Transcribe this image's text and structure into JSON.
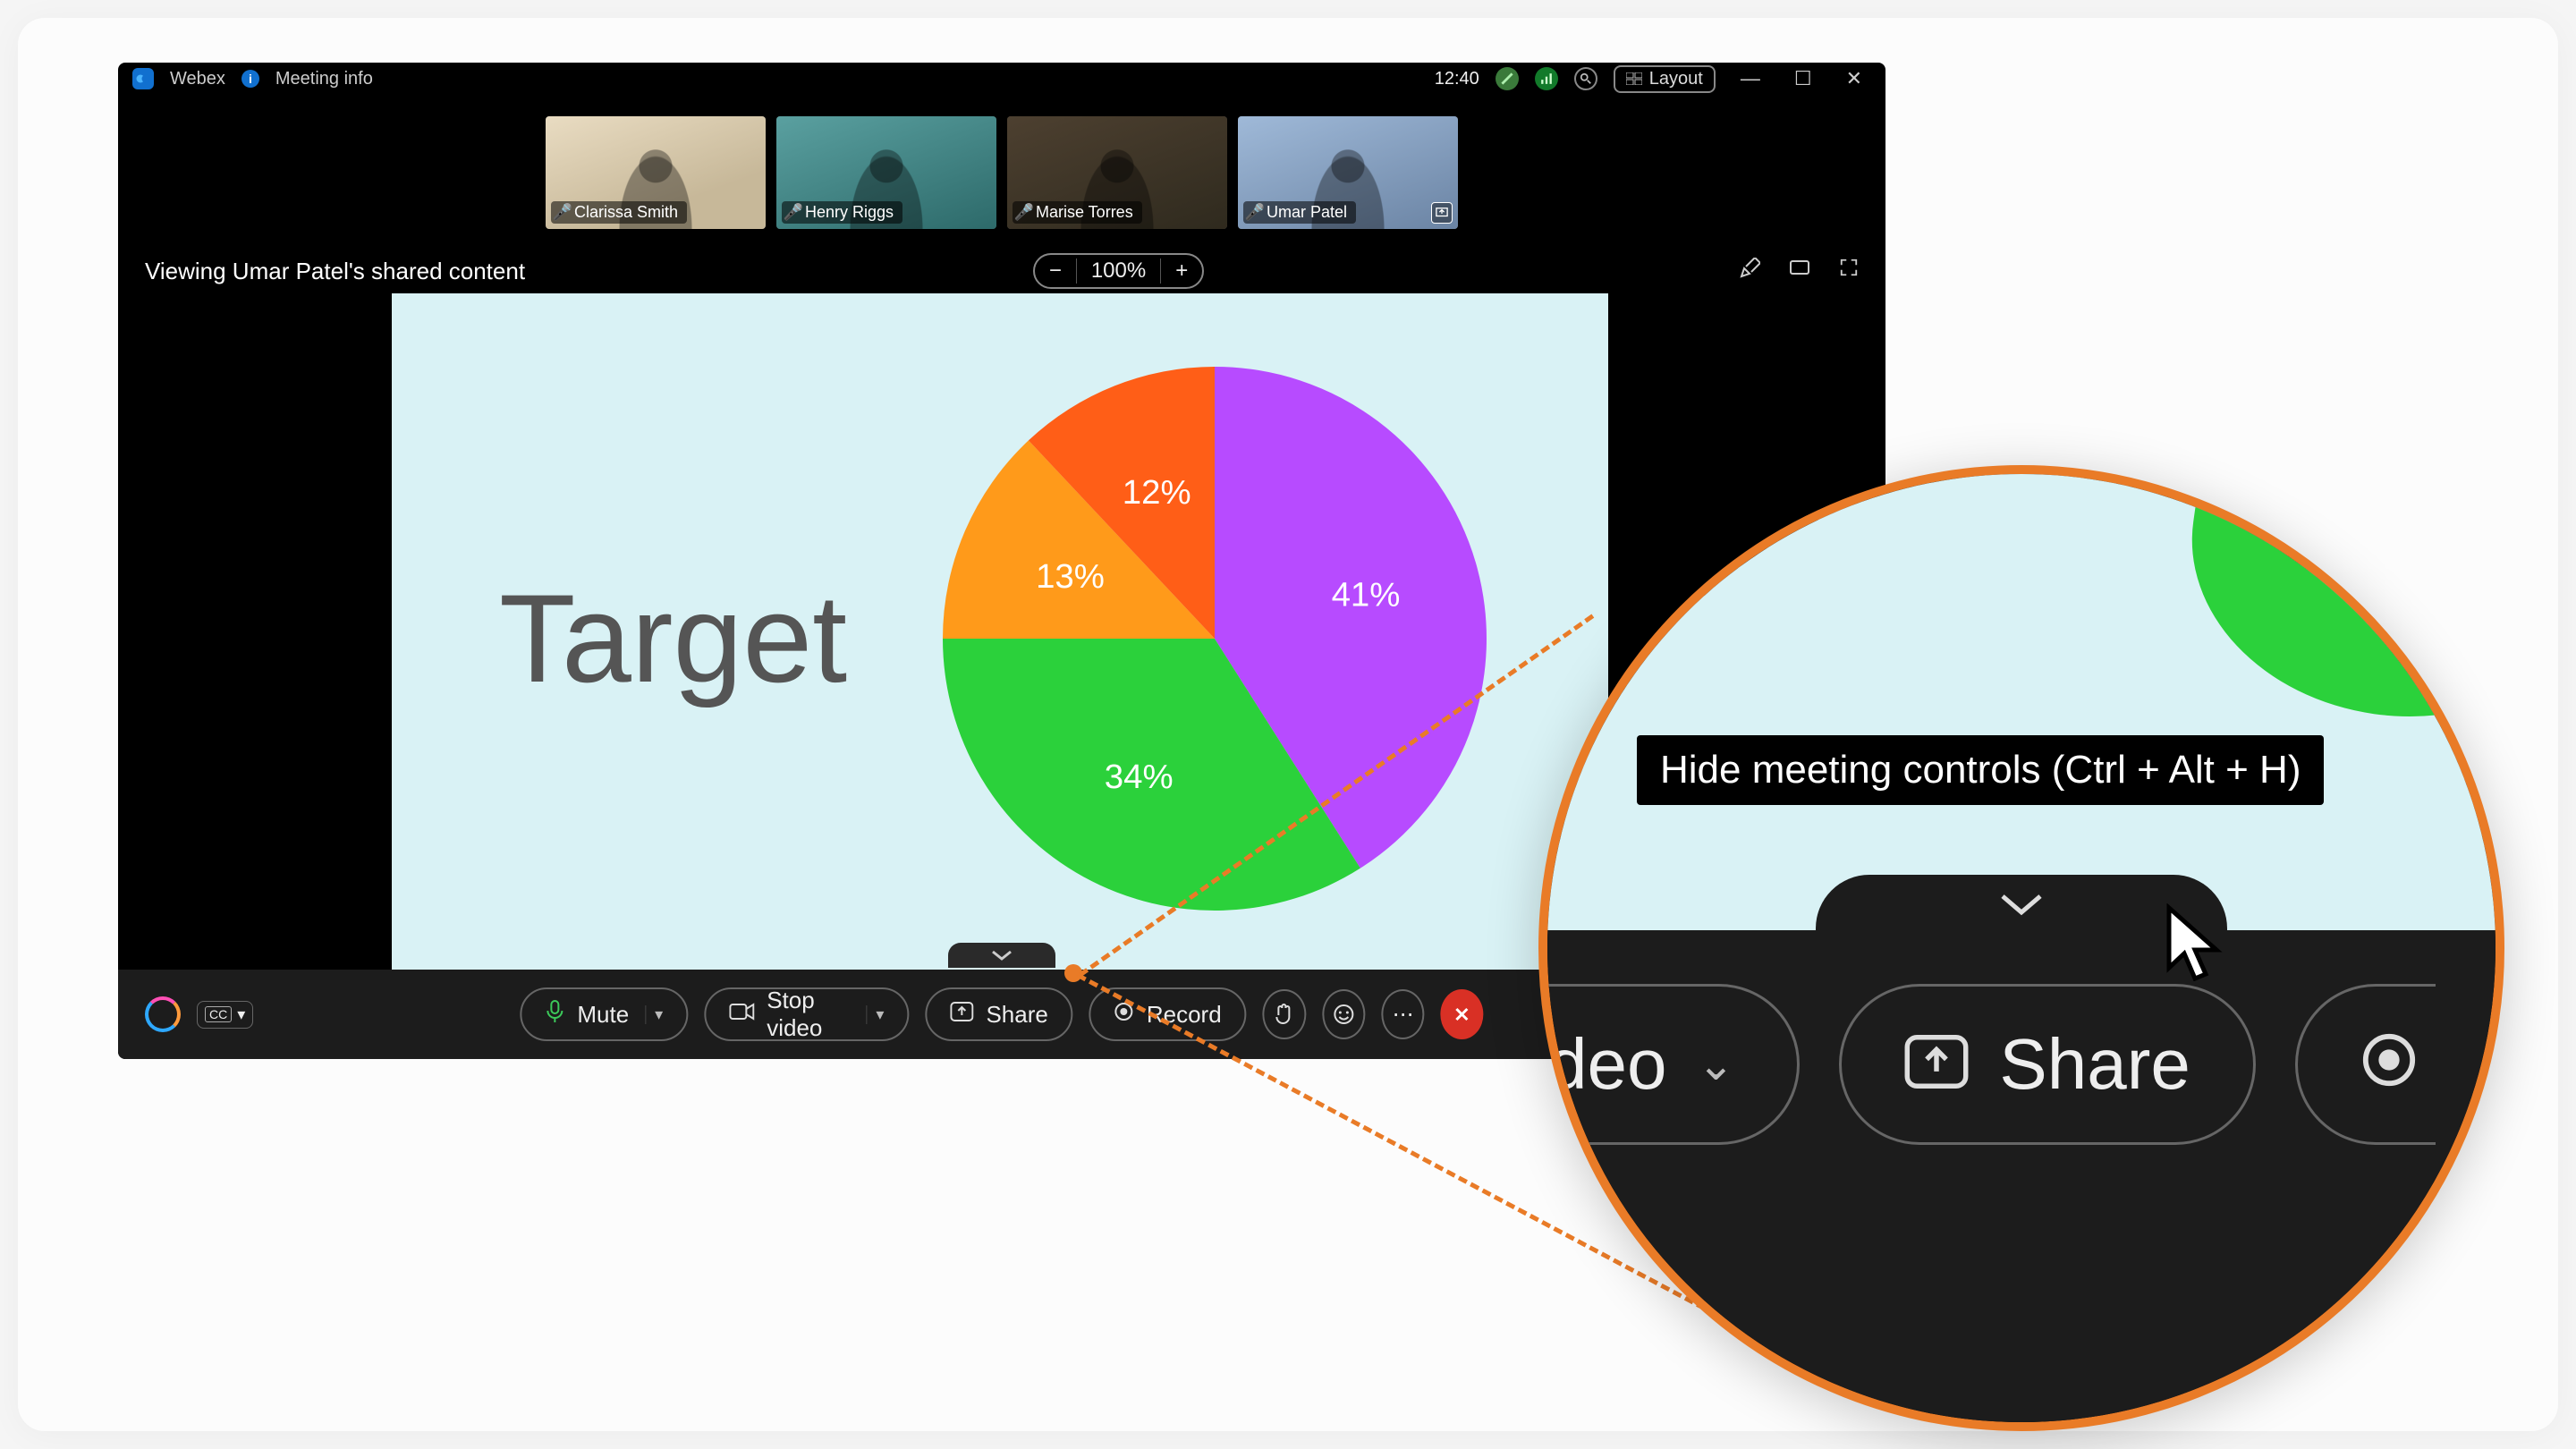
{
  "titlebar": {
    "app_name": "Webex",
    "meeting_info": "Meeting info",
    "time": "12:40",
    "layout_label": "Layout"
  },
  "participants": [
    {
      "name": "Clarissa Smith",
      "muted": false,
      "sharing": false
    },
    {
      "name": "Henry Riggs",
      "muted": true,
      "sharing": false
    },
    {
      "name": "Marise Torres",
      "muted": true,
      "sharing": false
    },
    {
      "name": "Umar Patel",
      "muted": true,
      "sharing": true
    }
  ],
  "content_header": {
    "viewing_label": "Viewing Umar Patel's shared content",
    "zoom": "100%"
  },
  "controls": {
    "mute": "Mute",
    "stop_video": "Stop video",
    "share": "Share",
    "record": "Record"
  },
  "tooltip": {
    "hide_controls": "Hide meeting controls (Ctrl + Alt + H)"
  },
  "magnifier": {
    "video_partial": "deo",
    "share": "Share"
  },
  "chart_data": {
    "type": "pie",
    "title": "Target",
    "series": [
      {
        "label": "41%",
        "value": 41,
        "color": "#b74bff"
      },
      {
        "label": "34%",
        "value": 34,
        "color": "#2bd13b"
      },
      {
        "label": "13%",
        "value": 13,
        "color": "#ff9a1a"
      },
      {
        "label": "12%",
        "value": 12,
        "color": "#ff5e17"
      }
    ]
  }
}
